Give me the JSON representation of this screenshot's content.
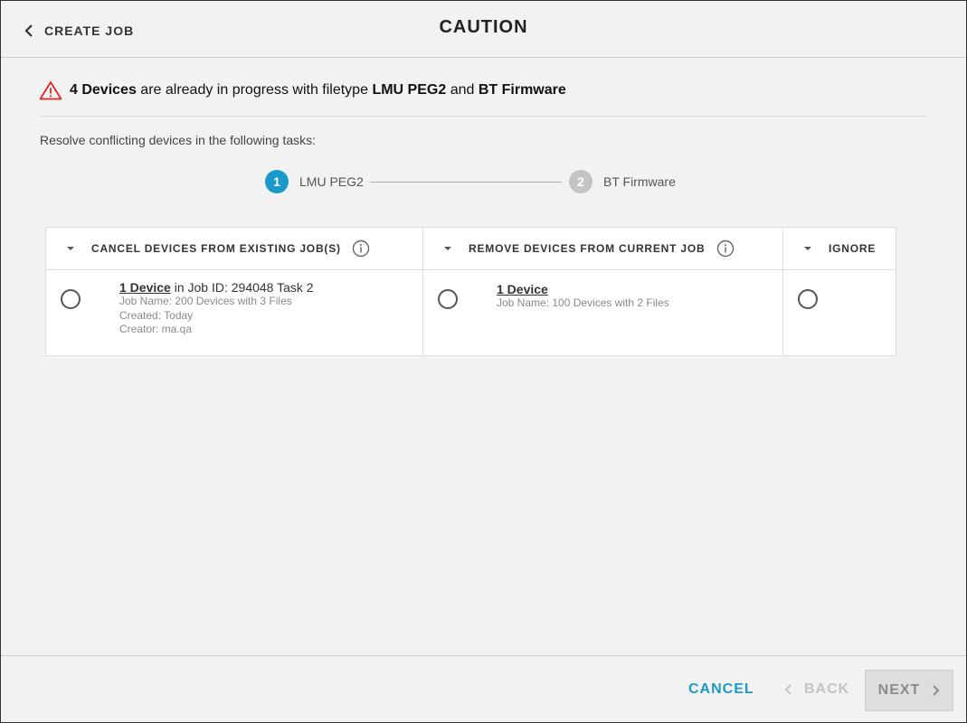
{
  "header": {
    "back_label": "CREATE JOB",
    "title": "CAUTION"
  },
  "warning": {
    "count_text": "4 Devices",
    "mid_text": "are already in progress with filetype",
    "filetype1": "LMU PEG2",
    "and_text": "and",
    "filetype2": "BT Firmware",
    "icon": "warning-triangle-icon",
    "icon_color": "#e02424"
  },
  "subtitle": "Resolve conflicting devices in the following tasks:",
  "stepper": {
    "steps": [
      {
        "number": "1",
        "label": "LMU PEG2",
        "active": true,
        "color": "#1a9ac9"
      },
      {
        "number": "2",
        "label": "BT Firmware",
        "active": false,
        "color": "#c4c4c4"
      }
    ]
  },
  "table": {
    "columns": [
      {
        "header": "CANCEL DEVICES FROM EXISTING JOB(S)",
        "has_info": true,
        "entry": {
          "device_link": "1 Device",
          "suffix": "in Job ID: 294048 Task 2",
          "meta": [
            "Job Name: 200 Devices with 3 Files",
            "Created: Today",
            "Creator: ma.qa"
          ]
        }
      },
      {
        "header": "REMOVE DEVICES FROM CURRENT JOB",
        "has_info": true,
        "entry": {
          "device_link": "1 Device",
          "suffix": "",
          "meta": [
            "Job Name: 100 Devices with 2 Files"
          ]
        }
      },
      {
        "header": "IGNORE",
        "has_info": false
      }
    ]
  },
  "footer": {
    "cancel_label": "CANCEL",
    "back_label": "BACK",
    "next_label": "NEXT",
    "accent_color": "#1a9ac9"
  }
}
